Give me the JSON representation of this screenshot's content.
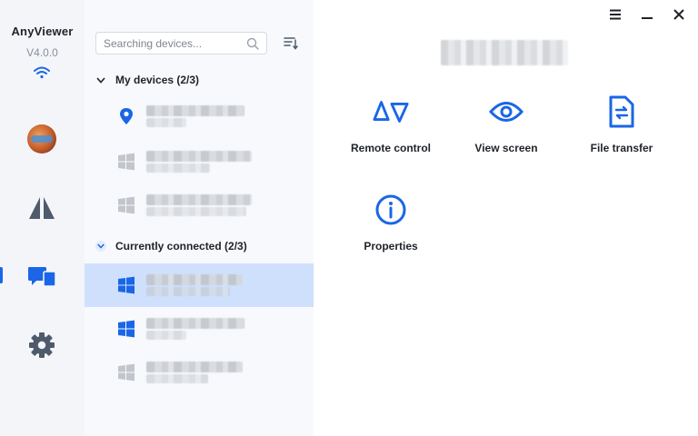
{
  "app": {
    "name": "AnyViewer",
    "version": "V4.0.0"
  },
  "colors": {
    "accent": "#1a66e6",
    "selected_row": "#cfe0fc",
    "rail_bg": "#f3f5f9",
    "panel_bg": "#f7f9fc"
  },
  "rail": {
    "items": [
      {
        "icon": "avatar-icon"
      },
      {
        "icon": "connect-triangle-icon"
      },
      {
        "icon": "devices-icon",
        "active": true
      },
      {
        "icon": "gear-icon"
      }
    ]
  },
  "search": {
    "placeholder": "Searching devices...",
    "value": ""
  },
  "groups": {
    "my_devices": {
      "label": "My devices (2/3)",
      "expanded": true
    },
    "connected": {
      "label": "Currently connected (2/3)",
      "expanded": true
    }
  },
  "devices": [
    {
      "icon": "location-pin-icon",
      "state": "online"
    },
    {
      "icon": "windows-icon",
      "state": "offline"
    },
    {
      "icon": "windows-icon",
      "state": "offline"
    },
    {
      "icon": "windows-icon",
      "state": "online",
      "selected": true
    },
    {
      "icon": "windows-icon",
      "state": "online"
    },
    {
      "icon": "windows-icon",
      "state": "offline"
    }
  ],
  "actions": {
    "remote_control": "Remote control",
    "view_screen": "View screen",
    "file_transfer": "File transfer",
    "properties": "Properties"
  }
}
